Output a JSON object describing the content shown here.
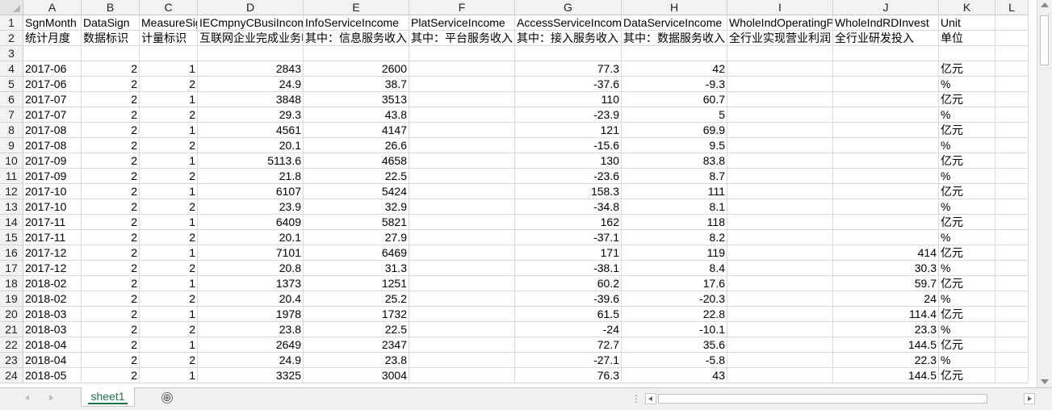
{
  "sheet": {
    "columns": [
      "A",
      "B",
      "C",
      "D",
      "E",
      "F",
      "G",
      "H",
      "I",
      "J",
      "K",
      "L"
    ],
    "rows": [
      [
        "SgnMonth",
        "DataSign",
        "MeasureSign",
        "IECmpnyCBusiIncome",
        "InfoServiceIncome",
        "PlatServiceIncome",
        "AccessServiceIncome",
        "DataServiceIncome",
        "WholeIndOperatingProfit",
        "WholeIndRDInvest",
        "Unit"
      ],
      [
        "统计月度",
        "数据标识",
        "计量标识",
        "互联网企业完成业务收入",
        "其中：信息服务收入",
        "其中：平台服务收入",
        "其中：接入服务收入",
        "其中：数据服务收入",
        "全行业实现营业利润",
        "全行业研发投入",
        "单位"
      ],
      [
        "",
        "",
        "",
        "",
        "",
        "",
        "",
        "",
        "",
        "",
        ""
      ],
      [
        "2017-06",
        "2",
        "1",
        "2843",
        "2600",
        "",
        "77.3",
        "42",
        "",
        "",
        "亿元"
      ],
      [
        "2017-06",
        "2",
        "2",
        "24.9",
        "38.7",
        "",
        "-37.6",
        "-9.3",
        "",
        "",
        "%"
      ],
      [
        "2017-07",
        "2",
        "1",
        "3848",
        "3513",
        "",
        "110",
        "60.7",
        "",
        "",
        "亿元"
      ],
      [
        "2017-07",
        "2",
        "2",
        "29.3",
        "43.8",
        "",
        "-23.9",
        "5",
        "",
        "",
        "%"
      ],
      [
        "2017-08",
        "2",
        "1",
        "4561",
        "4147",
        "",
        "121",
        "69.9",
        "",
        "",
        "亿元"
      ],
      [
        "2017-08",
        "2",
        "2",
        "20.1",
        "26.6",
        "",
        "-15.6",
        "9.5",
        "",
        "",
        "%"
      ],
      [
        "2017-09",
        "2",
        "1",
        "5113.6",
        "4658",
        "",
        "130",
        "83.8",
        "",
        "",
        "亿元"
      ],
      [
        "2017-09",
        "2",
        "2",
        "21.8",
        "22.5",
        "",
        "-23.6",
        "8.7",
        "",
        "",
        "%"
      ],
      [
        "2017-10",
        "2",
        "1",
        "6107",
        "5424",
        "",
        "158.3",
        "111",
        "",
        "",
        "亿元"
      ],
      [
        "2017-10",
        "2",
        "2",
        "23.9",
        "32.9",
        "",
        "-34.8",
        "8.1",
        "",
        "",
        "%"
      ],
      [
        "2017-11",
        "2",
        "1",
        "6409",
        "5821",
        "",
        "162",
        "118",
        "",
        "",
        "亿元"
      ],
      [
        "2017-11",
        "2",
        "2",
        "20.1",
        "27.9",
        "",
        "-37.1",
        "8.2",
        "",
        "",
        "%"
      ],
      [
        "2017-12",
        "2",
        "1",
        "7101",
        "6469",
        "",
        "171",
        "119",
        "",
        "414",
        "亿元"
      ],
      [
        "2017-12",
        "2",
        "2",
        "20.8",
        "31.3",
        "",
        "-38.1",
        "8.4",
        "",
        "30.3",
        "%"
      ],
      [
        "2018-02",
        "2",
        "1",
        "1373",
        "1251",
        "",
        "60.2",
        "17.6",
        "",
        "59.7",
        "亿元"
      ],
      [
        "2018-02",
        "2",
        "2",
        "20.4",
        "25.2",
        "",
        "-39.6",
        "-20.3",
        "",
        "24",
        "%"
      ],
      [
        "2018-03",
        "2",
        "1",
        "1978",
        "1732",
        "",
        "61.5",
        "22.8",
        "",
        "114.4",
        "亿元"
      ],
      [
        "2018-03",
        "2",
        "2",
        "23.8",
        "22.5",
        "",
        "-24",
        "-10.1",
        "",
        "23.3",
        "%"
      ],
      [
        "2018-04",
        "2",
        "1",
        "2649",
        "2347",
        "",
        "72.7",
        "35.6",
        "",
        "144.5",
        "亿元"
      ],
      [
        "2018-04",
        "2",
        "2",
        "24.9",
        "23.8",
        "",
        "-27.1",
        "-5.8",
        "",
        "22.3",
        "%"
      ],
      [
        "2018-05",
        "2",
        "1",
        "3325",
        "3004",
        "",
        "76.3",
        "43",
        "",
        "144.5",
        "亿元"
      ]
    ]
  },
  "tabs": {
    "sheet1_label": "sheet1",
    "add_icon": "⊕"
  }
}
